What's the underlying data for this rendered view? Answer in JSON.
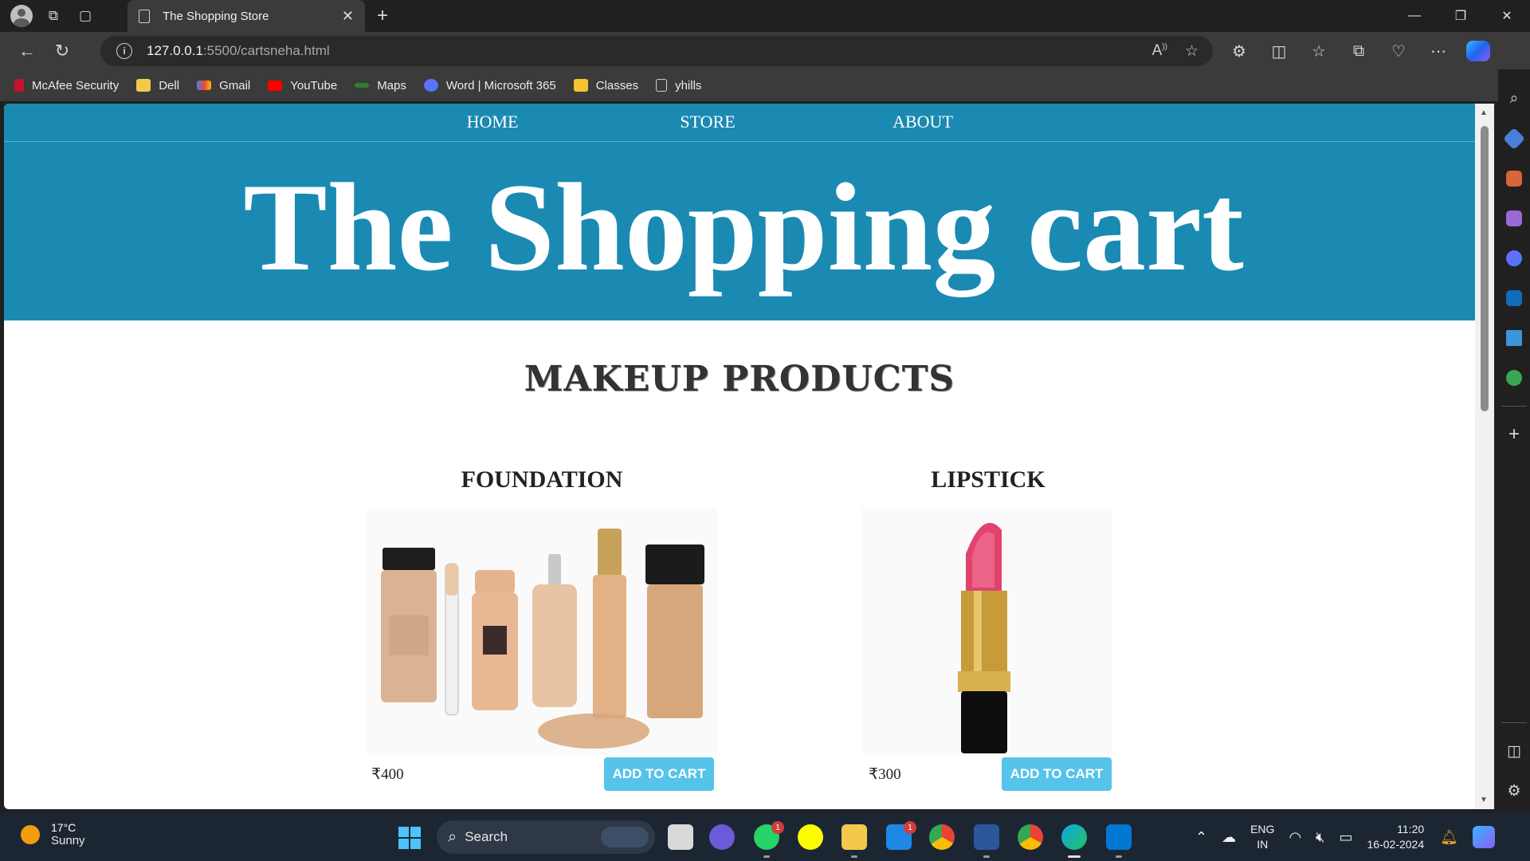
{
  "browser": {
    "tab_title": "The Shopping Store",
    "url_host": "127.0.0.1",
    "url_path": ":5500/cartsneha.html",
    "bookmarks": [
      "McAfee Security",
      "Dell",
      "Gmail",
      "YouTube",
      "Maps",
      "Word | Microsoft 365",
      "Classes",
      "yhills"
    ]
  },
  "site": {
    "nav": [
      "HOME",
      "STORE",
      "ABOUT"
    ],
    "title": "The Shopping cart",
    "section_title": "MAKEUP PRODUCTS",
    "products": [
      {
        "name": "FOUNDATION",
        "price": "₹400",
        "button": "ADD TO CART"
      },
      {
        "name": "LIPSTICK",
        "price": "₹300",
        "button": "ADD TO CART"
      }
    ]
  },
  "taskbar": {
    "weather_temp": "17°C",
    "weather_desc": "Sunny",
    "search_label": "Search",
    "lang_line1": "ENG",
    "lang_line2": "IN",
    "time": "11:20",
    "date": "16-02-2024",
    "whatsapp_badge": "1",
    "mail_badge": "1"
  },
  "colors": {
    "site_header": "#1a8ab3",
    "cart_button": "#56c3ea",
    "browser_chrome": "#3b3b3b"
  }
}
